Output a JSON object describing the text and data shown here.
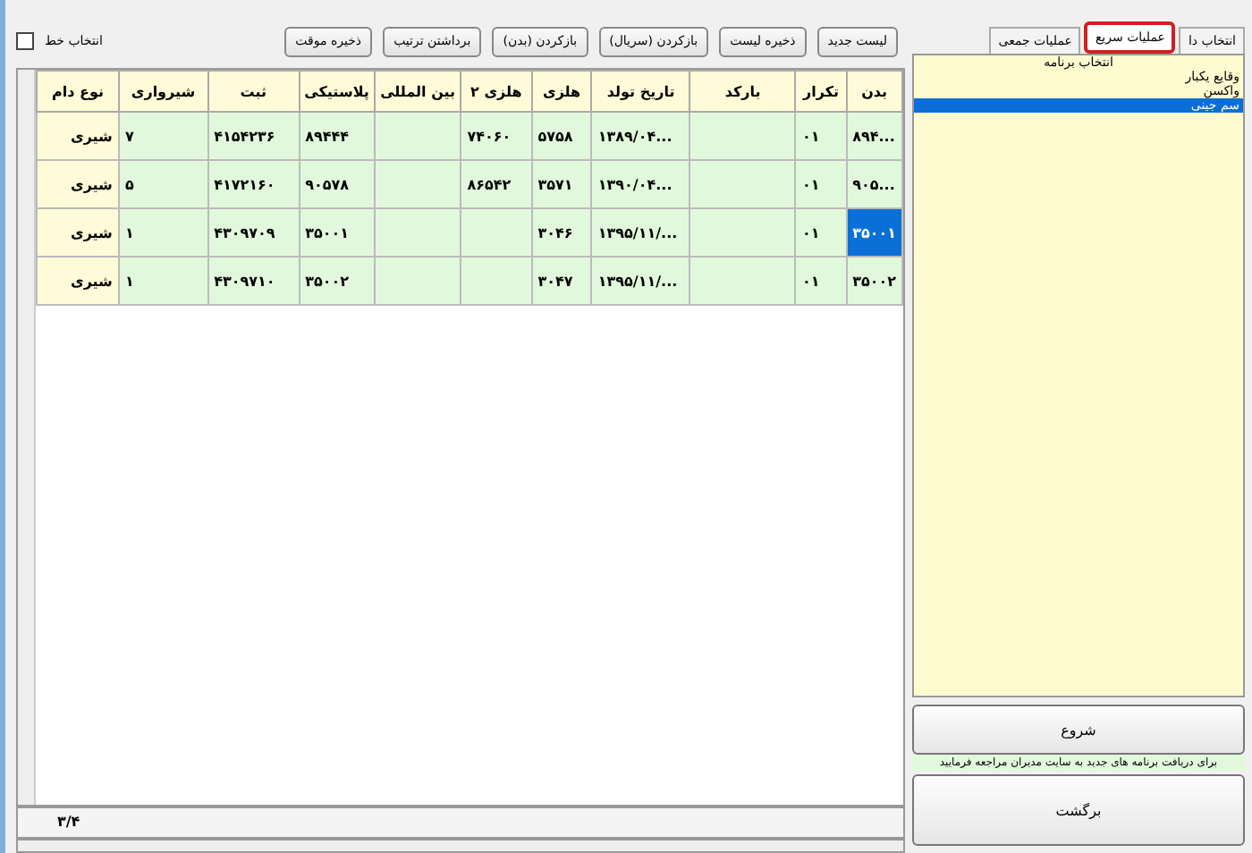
{
  "toolbar": {
    "buttons": [
      "لیست جدید",
      "ذخیره لیست",
      "بازکردن (سریال)",
      "بازکردن (بدن)",
      "برداشتن ترتیب",
      "ذخیره موقت"
    ],
    "select_line": {
      "label": "انتخاب خط",
      "checked": false
    }
  },
  "table": {
    "columns": [
      "بدن",
      "تکرار",
      "بارکد",
      "تاریخ تولد",
      "هلزی",
      "هلزی ۲",
      "بین المللی",
      "پلاستیکی",
      "ثبت",
      "شیرواری",
      "نوع دام"
    ],
    "rows": [
      {
        "cells": [
          "...۸۹۴",
          "۰۱",
          null,
          "...۱۳۸۹/۰۴",
          "۵۷۵۸",
          "۷۴۰۶۰",
          null,
          "۸۹۴۴۴",
          "۴۱۵۴۲۳۶",
          "۷",
          "شیری"
        ],
        "selected": false
      },
      {
        "cells": [
          "...۹۰۵",
          "۰۱",
          null,
          "...۱۳۹۰/۰۴",
          "۳۵۷۱",
          "۸۶۵۴۲",
          null,
          "۹۰۵۷۸",
          "۴۱۷۲۱۶۰",
          "۵",
          "شیری"
        ],
        "selected": false
      },
      {
        "cells": [
          "۳۵۰۰۱",
          "۰۱",
          null,
          ".../۱۳۹۵/۱۱",
          "۳۰۴۶",
          null,
          null,
          "۳۵۰۰۱",
          "۴۳۰۹۷۰۹",
          "۱",
          "شیری"
        ],
        "selected": true
      },
      {
        "cells": [
          "۳۵۰۰۲",
          "۰۱",
          null,
          ".../۱۳۹۵/۱۱",
          "۳۰۴۷",
          null,
          null,
          "۳۵۰۰۲",
          "۴۳۰۹۷۱۰",
          "۱",
          "شیری"
        ],
        "selected": false
      }
    ],
    "footer": "۳/۴"
  },
  "side_panel": {
    "tabs": [
      {
        "label": "انتخاب دا",
        "selected": false
      },
      {
        "label": "عملیات سریع",
        "selected": true
      },
      {
        "label": "عملیات جمعی",
        "selected": false
      }
    ],
    "list_header": "انتخاب برنامه",
    "items": [
      {
        "label": "وقایع یکبار",
        "selected": false
      },
      {
        "label": "واکسن",
        "selected": false
      },
      {
        "label": "سم جینی",
        "selected": true
      }
    ],
    "start_button": "شروع",
    "note": "برای دریافت برنامه های جدید به سایت مدیران مراجعه فرمایید",
    "back_button": "برگشت"
  }
}
